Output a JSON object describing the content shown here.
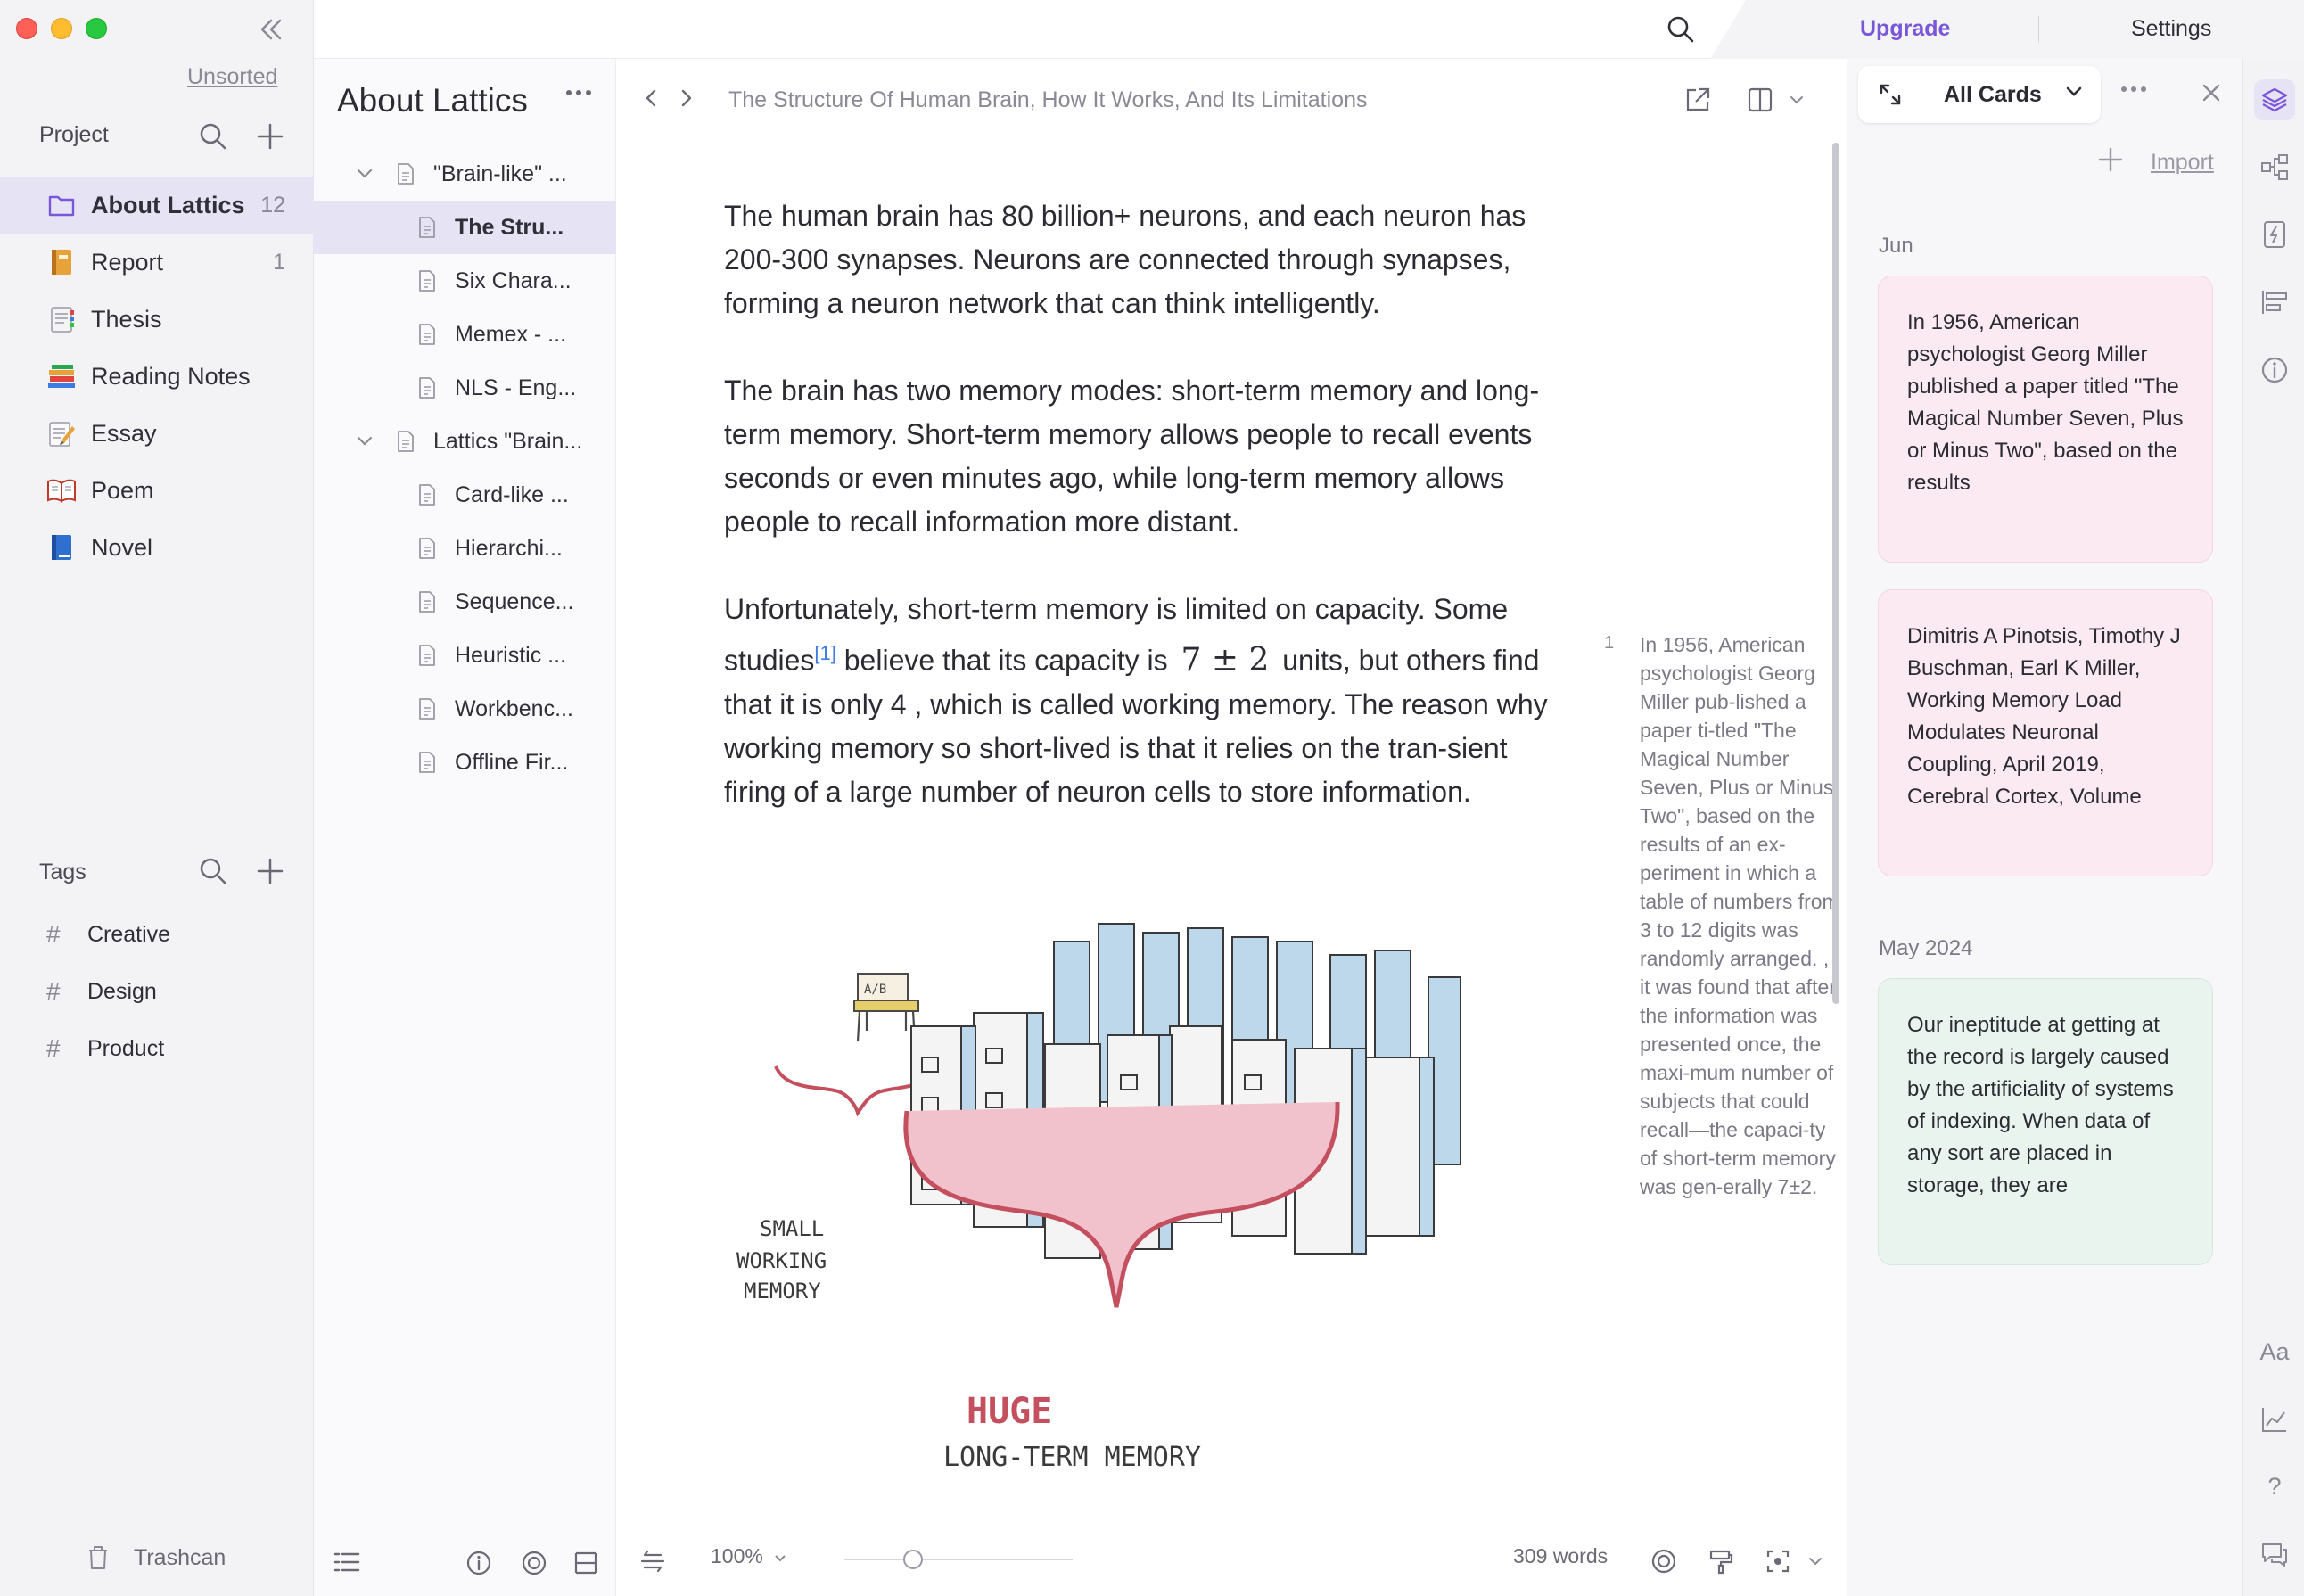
{
  "sidebar": {
    "unsorted_label": "Unsorted",
    "project_heading": "Project",
    "projects": [
      {
        "label": "About Lattics",
        "count": "12",
        "icon": "folder-icon",
        "active": true
      },
      {
        "label": "Report",
        "count": "1",
        "icon": "notebook-icon"
      },
      {
        "label": "Thesis",
        "count": "",
        "icon": "bookmark-tabs-icon"
      },
      {
        "label": "Reading Notes",
        "count": "",
        "icon": "books-icon"
      },
      {
        "label": "Essay",
        "count": "",
        "icon": "memo-icon"
      },
      {
        "label": "Poem",
        "count": "",
        "icon": "open-book-icon"
      },
      {
        "label": "Novel",
        "count": "",
        "icon": "blue-book-icon"
      }
    ],
    "tags_heading": "Tags",
    "tags": [
      "Creative",
      "Design",
      "Product"
    ],
    "trash_label": "Trashcan"
  },
  "tree": {
    "title": "About Lattics",
    "items": [
      {
        "label": "\"Brain-like\" ...",
        "level": 0,
        "expanded": true
      },
      {
        "label": "The Stru...",
        "level": 1,
        "active": true
      },
      {
        "label": "Six Chara...",
        "level": 1
      },
      {
        "label": "Memex - ...",
        "level": 1
      },
      {
        "label": "NLS - Eng...",
        "level": 1
      },
      {
        "label": "Lattics \"Brain...",
        "level": 0,
        "expanded": true
      },
      {
        "label": "Card-like ...",
        "level": 1
      },
      {
        "label": "Hierarchi...",
        "level": 1
      },
      {
        "label": "Sequence...",
        "level": 1
      },
      {
        "label": "Heuristic ...",
        "level": 1
      },
      {
        "label": "Workbenc...",
        "level": 1
      },
      {
        "label": "Offline Fir...",
        "level": 1
      }
    ]
  },
  "topbar": {
    "upgrade_label": "Upgrade",
    "settings_label": "Settings"
  },
  "editor": {
    "doc_title": "The Structure Of Human Brain, How It Works, And Its Limitations",
    "para1": "The human brain has 80 billion+ neurons, and each neuron has 200-300 synapses. Neurons are connected through synapses, forming a neuron network that can think intelligently.",
    "para2": "The brain has two memory modes: short-term memory and long-term memory. Short-term memory allows people to recall events seconds or even minutes ago, while long-term memory allows people to recall information more distant.",
    "para3_a": "Unfortunately, short-term memory is limited on capacity. Some studies",
    "para3_ref": "[1]",
    "para3_b": " believe that its capacity is ",
    "para3_math": "7 ± 2",
    "para3_c": " units, but others find that it is only 4 , which is called working memory. The reason why working memory so short-lived is that it relies on the tran-sient firing of a large number of neuron cells to store information.",
    "illustration": {
      "small_label_1": "SMALL",
      "small_label_2": "WORKING",
      "small_label_3": "MEMORY",
      "huge_label": "HUGE",
      "long_label": "LONG-TERM MEMORY",
      "desk_sign": "A/B"
    },
    "footnote_number": "1",
    "footnote_text": "In 1956, American psychologist Georg Miller pub-lished a paper ti-tled \"The Magical Number Seven, Plus or Minus Two\", based on the results of an ex-periment in which a table of numbers from 3 to 12 digits was randomly arranged. , it was found that after the information was presented once, the maxi-mum number of subjects that could recall—the capaci-ty of short-term memory was gen-erally 7±2.",
    "zoom_label": "100%",
    "zoom_value": 0.3,
    "word_count": "309 words"
  },
  "cards_panel": {
    "filter_label": "All Cards",
    "import_label": "Import",
    "groups": [
      {
        "month": "Jun",
        "cards": [
          {
            "text": "In 1956, American psychologist Georg Miller published a paper titled \"The Magical Number Seven, Plus or Minus Two\", based on the results",
            "color": "#fbeaf1"
          },
          {
            "text": "Dimitris A Pinotsis, Timothy J Buschman, Earl K Miller, Working Memory Load Modulates Neuronal Coupling, April 2019, Cerebral Cortex, Volume",
            "color": "#fbeaf1"
          }
        ]
      },
      {
        "month": "May 2024",
        "cards": [
          {
            "text": "Our ineptitude at getting at the record is largely caused by the artificiality of systems of indexing. When data of any sort are placed in storage, they are",
            "color": "#e9f4ee"
          }
        ]
      }
    ]
  },
  "rail": {
    "font_label": "Aa",
    "help_label": "?"
  },
  "colors": {
    "accent": "#7a56d8",
    "active_bg": "#e6e3f5",
    "link": "#3d7be0"
  }
}
